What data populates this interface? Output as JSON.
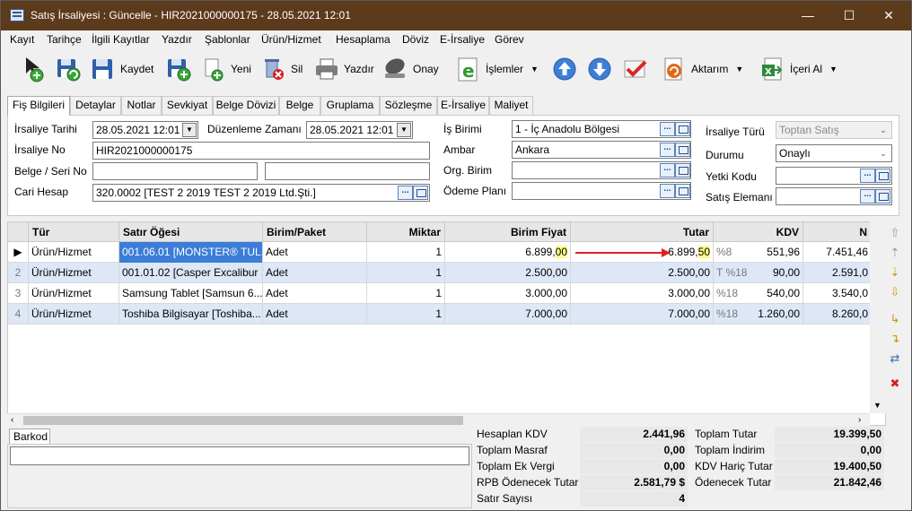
{
  "window": {
    "title": "Satış İrsaliyesi : Güncelle - HIR2021000000175 - 28.05.2021 12:01"
  },
  "menu": [
    "Kayıt",
    "Tarihçe",
    "İlgili Kayıtlar",
    "Yazdır",
    "Şablonlar",
    "Ürün/Hizmet",
    "Hesaplama",
    "Döviz",
    "E-İrsaliye",
    "Görev"
  ],
  "toolbar": {
    "save": "Kaydet",
    "new": "Yeni",
    "delete": "Sil",
    "print": "Yazdır",
    "approve": "Onay",
    "operations": "İşlemler",
    "transfer": "Aktarım",
    "import": "İçeri Al"
  },
  "tabs": [
    "Fiş Bilgileri",
    "Detaylar",
    "Notlar",
    "Sevkiyat",
    "Belge Dövizi",
    "Belge",
    "Gruplama",
    "Sözleşme",
    "E-İrsaliye",
    "Maliyet"
  ],
  "form": {
    "irsaliye_tarihi_label": "İrsaliye Tarihi",
    "irsaliye_tarihi": "28.05.2021 12:01",
    "duzenleme_zamani_label": "Düzenleme Zamanı",
    "duzenleme_zamani": "28.05.2021 12:01",
    "irsaliye_no_label": "İrsaliye No",
    "irsaliye_no": "HIR2021000000175",
    "belge_seri_no_label": "Belge / Seri No",
    "belge_no": "",
    "seri_no": "",
    "cari_hesap_label": "Cari Hesap",
    "cari_hesap": "320.0002 [TEST 2 2019 TEST 2 2019 Ltd.Şti.]",
    "is_birimi_label": "İş Birimi",
    "is_birimi": "1 - İç Anadolu Bölgesi",
    "ambar_label": "Ambar",
    "ambar": "Ankara",
    "org_birim_label": "Org. Birim",
    "org_birim": "",
    "odeme_plani_label": "Ödeme Planı",
    "odeme_plani": "",
    "irsaliye_turu_label": "İrsaliye Türü",
    "irsaliye_turu": "Toptan Satış",
    "durumu_label": "Durumu",
    "durumu": "Onaylı",
    "yetki_kodu_label": "Yetki Kodu",
    "yetki_kodu": "",
    "satis_elemani_label": "Satış Elemanı",
    "satis_elemani": ""
  },
  "grid": {
    "columns": [
      "Tür",
      "Satır Öğesi",
      "Birim/Paket",
      "Miktar",
      "Birim Fiyat",
      "Tutar",
      "KDV",
      "N"
    ],
    "rows": [
      {
        "no": "",
        "tur": "Ürün/Hizmet",
        "satir": "001.06.01 [MONSTER® TUL...",
        "birim": "Adet",
        "miktar": "1",
        "fiyat_main": "6.899,",
        "fiyat_dec": "00",
        "tutar_main": "6.899,",
        "tutar_dec": "50",
        "kdv_oran": "%8",
        "kdv": "551,96",
        "net": "7.451,46"
      },
      {
        "no": "2",
        "tur": "Ürün/Hizmet",
        "satir": "001.01.02 [Casper Excalibur ...",
        "birim": "Adet",
        "miktar": "1",
        "fiyat": "2.500,00",
        "tutar": "2.500,00",
        "kdv_oran": "T %18",
        "kdv": "90,00",
        "net": "2.591,0"
      },
      {
        "no": "3",
        "tur": "Ürün/Hizmet",
        "satir": "Samsung Tablet [Samsun 6...",
        "birim": "Adet",
        "miktar": "1",
        "fiyat": "3.000,00",
        "tutar": "3.000,00",
        "kdv_oran": "%18",
        "kdv": "540,00",
        "net": "3.540,0"
      },
      {
        "no": "4",
        "tur": "Ürün/Hizmet",
        "satir": "Toshiba Bilgisayar [Toshiba...",
        "birim": "Adet",
        "miktar": "1",
        "fiyat": "7.000,00",
        "tutar": "7.000,00",
        "kdv_oran": "%18",
        "kdv": "1.260,00",
        "net": "8.260,0"
      }
    ]
  },
  "barkod": {
    "tab": "Barkod",
    "value": ""
  },
  "totals": {
    "hesaplan_kdv_label": "Hesaplan KDV",
    "hesaplan_kdv": "2.441,96",
    "toplam_masraf_label": "Toplam Masraf",
    "toplam_masraf": "0,00",
    "toplam_ek_vergi_label": "Toplam Ek Vergi",
    "toplam_ek_vergi": "0,00",
    "rpb_odenecek_label": "RPB Ödenecek Tutar",
    "rpb_odenecek": "2.581,79 $",
    "satir_sayisi_label": "Satır Sayısı",
    "satir_sayisi": "4",
    "toplam_tutar_label": "Toplam Tutar",
    "toplam_tutar": "19.399,50",
    "toplam_indirim_label": "Toplam İndirim",
    "toplam_indirim": "0,00",
    "kdv_haric_label": "KDV Hariç Tutar",
    "kdv_haric": "19.400,50",
    "odenecek_label": "Ödenecek Tutar",
    "odenecek": "21.842,46"
  },
  "colors": {
    "titlebar": "#5c3a1c",
    "selection": "#3b7dd8",
    "row_alt": "#dde7f6",
    "highlight": "#fffb8a",
    "arrow": "#e02020"
  }
}
